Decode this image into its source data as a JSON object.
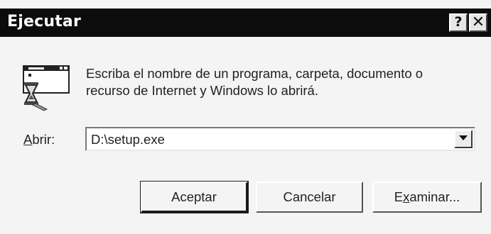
{
  "window": {
    "title": "Ejecutar",
    "help_glyph": "?",
    "close_glyph": "✕"
  },
  "dialog": {
    "description_line1": "Escriba el nombre de un programa, carpeta, documento o",
    "description_line2": "recurso de Internet y Windows lo abrirá.",
    "icon": "run-icon",
    "open_label_accel": "A",
    "open_label_rest": "brir:",
    "open_value": "D:\\setup.exe"
  },
  "buttons": {
    "ok_label": "Aceptar",
    "cancel_label": "Cancelar",
    "browse_label_pre": "E",
    "browse_label_accel": "x",
    "browse_label_post": "aminar..."
  },
  "colors": {
    "titlebar": "#0c0c0c",
    "dialog_bg": "#f4f4f4"
  }
}
